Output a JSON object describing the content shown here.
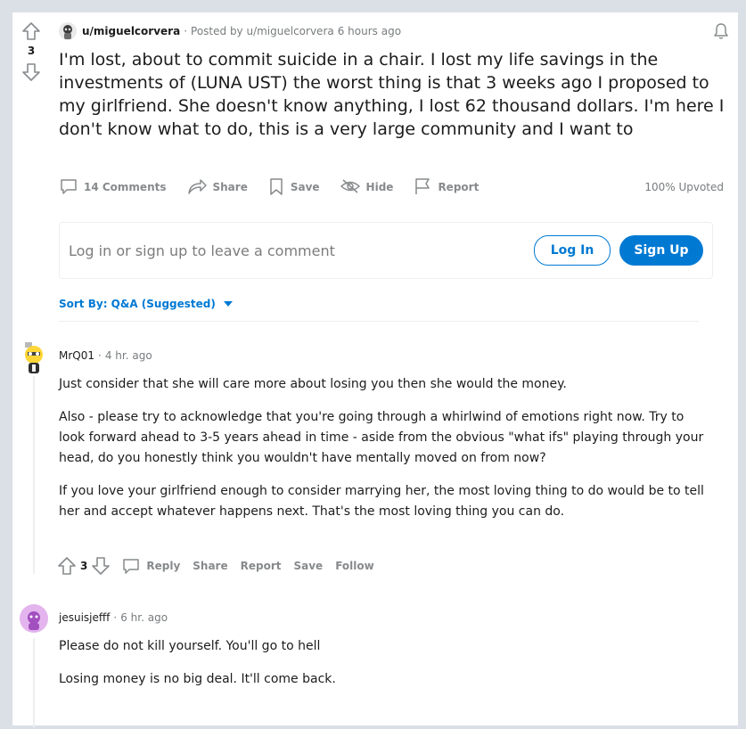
{
  "colors": {
    "accent": "#0079d3",
    "background": "#dae0e6",
    "muted": "#878a8c"
  },
  "post": {
    "vote_count": "3",
    "author": "u/miguelcorvera",
    "posted_by": "Posted by u/miguelcorvera",
    "time": "6 hours ago",
    "title": "I'm lost, about to commit suicide in a chair. I lost my life savings in the investments of (LUNA UST) the worst thing is that 3 weeks ago I proposed to my girlfriend. She doesn't know anything, I lost 62 thousand dollars. I'm here I don't know what to do, this is a very large community and I want to",
    "actions": {
      "comments": "14 Comments",
      "share": "Share",
      "save": "Save",
      "hide": "Hide",
      "report": "Report"
    },
    "upvoted": "100% Upvoted"
  },
  "login_prompt": {
    "text": "Log in or sign up to leave a comment",
    "login_label": "Log In",
    "signup_label": "Sign Up"
  },
  "sort": {
    "label": "Sort By: Q&A (Suggested)"
  },
  "comments": [
    {
      "author": "MrQ01",
      "time": "4 hr. ago",
      "paragraphs": [
        "Just consider that she will care more about losing you then she would the money.",
        "Also - please try to acknowledge that you're going through a whirlwind of emotions right now. Try to look forward ahead to 3-5 years ahead in time - aside from the obvious \"what ifs\" playing through your head, do you honestly think you wouldn't have mentally moved on from now?",
        "If you love your girlfriend enough to consider marrying her, the most loving thing to do would be to tell her and accept whatever happens next. That's the most loving thing you can do."
      ],
      "votes": "3",
      "actions": {
        "reply": "Reply",
        "share": "Share",
        "report": "Report",
        "save": "Save",
        "follow": "Follow"
      }
    },
    {
      "author": "jesuisjefff",
      "time": "6 hr. ago",
      "paragraphs": [
        "Please do not kill yourself. You'll go to hell",
        "Losing money is no big deal. It'll come back."
      ]
    }
  ]
}
